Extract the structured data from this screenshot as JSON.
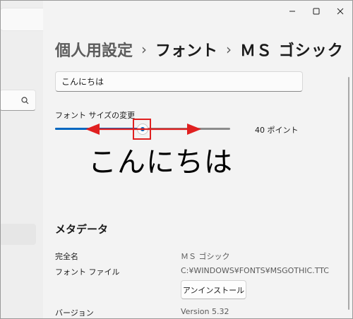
{
  "window": {
    "controls": {
      "minimize": "—",
      "maximize": "☐",
      "close": "✕"
    }
  },
  "breadcrumb": {
    "parent": "個人用設定",
    "middle": "フォント",
    "current": "ＭＳ ゴシック",
    "separator": "›"
  },
  "preview": {
    "value": "こんにちは",
    "placeholder": ""
  },
  "font_size": {
    "label": "フォント サイズの変更",
    "value_text": "40 ポイント",
    "slider_fraction": 0.5
  },
  "sample_text": "こんにちは",
  "metadata": {
    "heading": "メタデータ",
    "rows": [
      {
        "label": "完全名",
        "value": "ＭＳ ゴシック"
      },
      {
        "label": "フォント ファイル",
        "value": "C:¥WINDOWS¥FONTS¥MSGOTHIC.TTC"
      },
      {
        "label": "バージョン",
        "value": "Version 5.32"
      }
    ],
    "uninstall_label": "アンインストール"
  },
  "colors": {
    "accent": "#0067c0",
    "annotation": "#e02020"
  },
  "icons": {
    "search": "search-icon"
  }
}
